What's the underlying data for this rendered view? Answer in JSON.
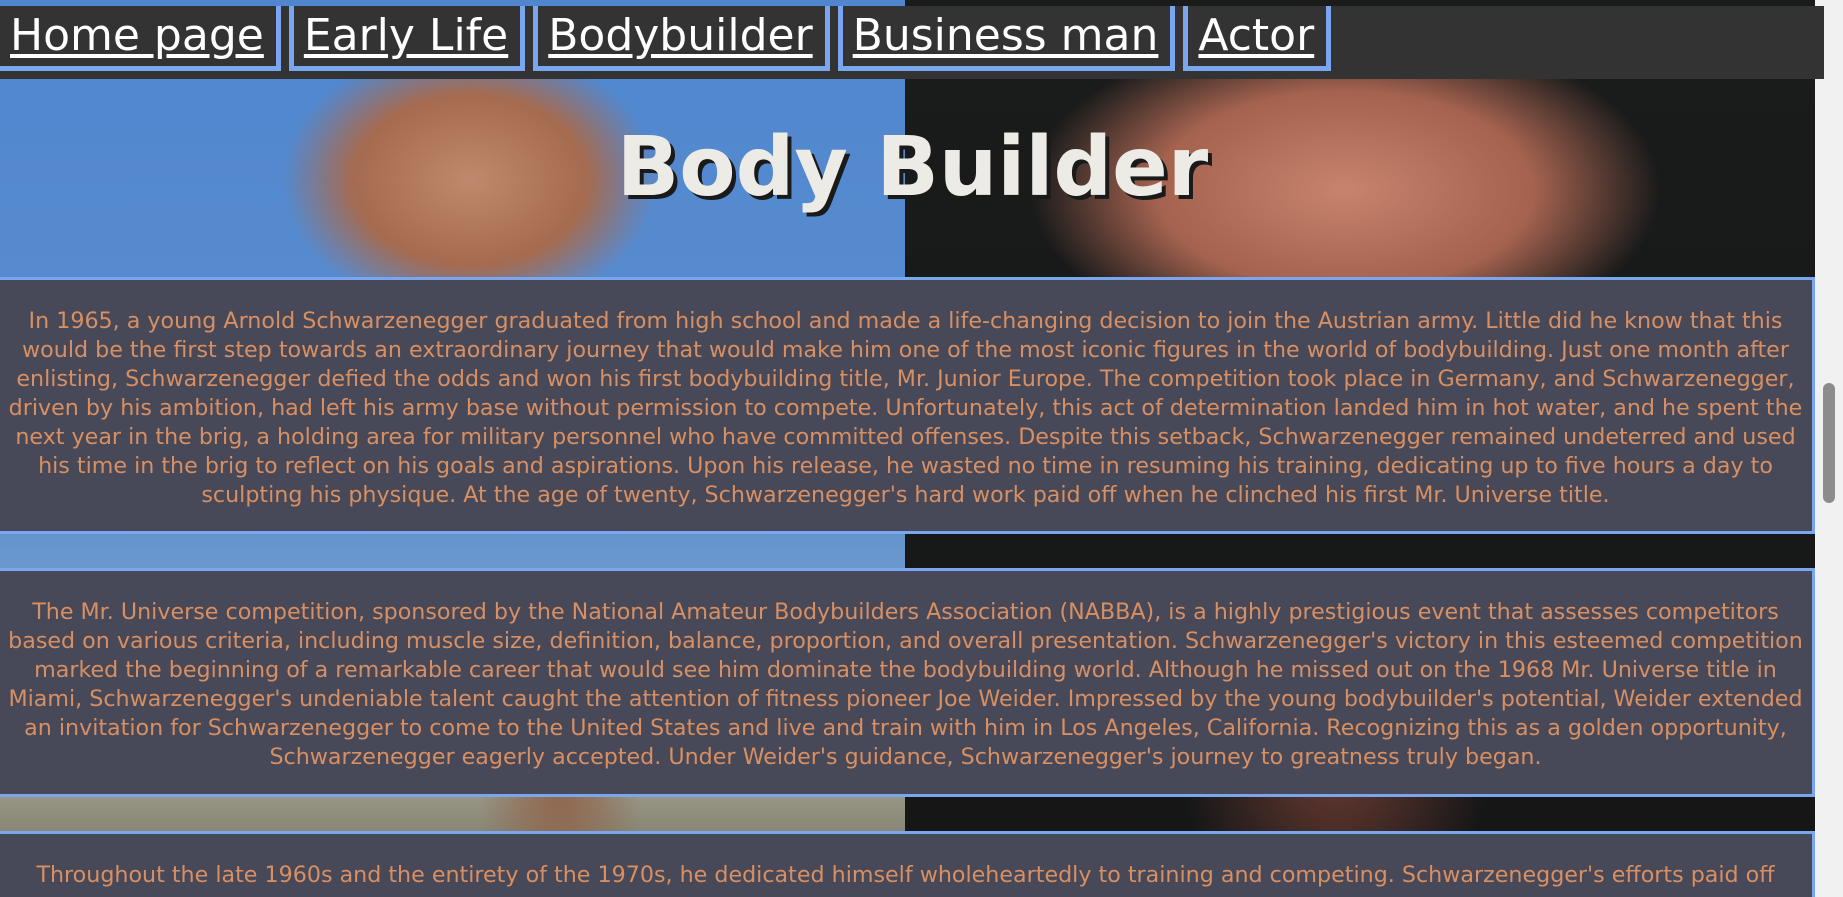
{
  "nav": {
    "items": [
      {
        "label": "Home page"
      },
      {
        "label": "Early Life"
      },
      {
        "label": "Bodybuilder"
      },
      {
        "label": "Business man"
      },
      {
        "label": "Actor"
      }
    ]
  },
  "title": "Body Builder",
  "paragraphs": [
    "In 1965, a young Arnold Schwarzenegger graduated from high school and made a life-changing decision to join the Austrian army. Little did he know that this would be the first step towards an extraordinary journey that would make him one of the most iconic figures in the world of bodybuilding. Just one month after enlisting, Schwarzenegger defied the odds and won his first bodybuilding title, Mr. Junior Europe. The competition took place in Germany, and Schwarzenegger, driven by his ambition, had left his army base without permission to compete. Unfortunately, this act of determination landed him in hot water, and he spent the next year in the brig, a holding area for military personnel who have committed offenses. Despite this setback, Schwarzenegger remained undeterred and used his time in the brig to reflect on his goals and aspirations. Upon his release, he wasted no time in resuming his training, dedicating up to five hours a day to sculpting his physique. At the age of twenty, Schwarzenegger's hard work paid off when he clinched his first Mr. Universe title.",
    "The Mr. Universe competition, sponsored by the National Amateur Bodybuilders Association (NABBA), is a highly prestigious event that assesses competitors based on various criteria, including muscle size, definition, balance, proportion, and overall presentation. Schwarzenegger's victory in this esteemed competition marked the beginning of a remarkable career that would see him dominate the bodybuilding world. Although he missed out on the 1968 Mr. Universe title in Miami, Schwarzenegger's undeniable talent caught the attention of fitness pioneer Joe Weider. Impressed by the young bodybuilder's potential, Weider extended an invitation for Schwarzenegger to come to the United States and live and train with him in Los Angeles, California. Recognizing this as a golden opportunity, Schwarzenegger eagerly accepted. Under Weider's guidance, Schwarzenegger's journey to greatness truly began.",
    "Throughout the late 1960s and the entirety of the 1970s, he dedicated himself wholeheartedly to training and competing. Schwarzenegger's efforts paid off"
  ],
  "colors": {
    "nav_bg": "#333333",
    "nav_border": "#7aa6f0",
    "panel_bg": "#474858",
    "panel_text": "#d88f62",
    "title_text": "#ecebe6"
  }
}
